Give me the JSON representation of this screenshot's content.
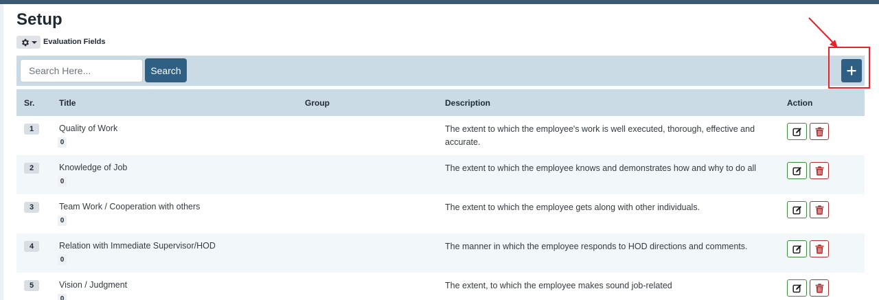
{
  "page": {
    "title": "Setup"
  },
  "breadcrumb": {
    "settings_icon": "gear-icon",
    "label": "Evaluation Fields"
  },
  "toolbar": {
    "search_placeholder": "Search Here...",
    "search_value": "",
    "search_label": "Search",
    "add_icon": "plus-icon"
  },
  "table": {
    "headers": {
      "sr": "Sr.",
      "title": "Title",
      "group": "Group",
      "description": "Description",
      "action": "Action"
    },
    "rows": [
      {
        "sr": "1",
        "title": "Quality of Work",
        "count": "0",
        "group": "",
        "description": "The extent to which the employee's work is well executed, thorough, effective and accurate."
      },
      {
        "sr": "2",
        "title": "Knowledge of Job",
        "count": "0",
        "group": "",
        "description": "The extent to which the employee knows and demonstrates how and why to do all"
      },
      {
        "sr": "3",
        "title": "Team Work / Cooperation with others",
        "count": "0",
        "group": "",
        "description": "The extent to which the employee gets along with other individuals."
      },
      {
        "sr": "4",
        "title": "Relation with Immediate Supervisor/HOD",
        "count": "0",
        "group": "",
        "description": "The manner in which the employee responds to HOD directions and comments."
      },
      {
        "sr": "5",
        "title": "Vision / Judgment",
        "count": "0",
        "group": "",
        "description": "The extent, to which the employee makes sound job-related"
      }
    ]
  },
  "colors": {
    "primary": "#2f5f82",
    "toolbar_bg": "#cbdbe6",
    "highlight": "#e8242b",
    "edit": "#3c8a3c",
    "delete": "#a83232"
  }
}
